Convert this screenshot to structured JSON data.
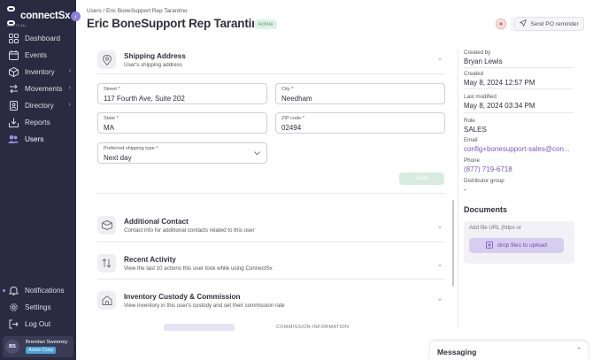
{
  "brand": {
    "name": "connectSx",
    "sub": "ASC-IT-ALL"
  },
  "sidebar": {
    "items": [
      {
        "label": "Dashboard",
        "icon": "dashboard-icon"
      },
      {
        "label": "Events",
        "icon": "calendar-icon"
      },
      {
        "label": "Inventory",
        "icon": "box-icon",
        "chevron": "›"
      },
      {
        "label": "Movements",
        "icon": "arrows-icon",
        "chevron": "›"
      },
      {
        "label": "Directory",
        "icon": "directory-icon",
        "chevron": "›"
      },
      {
        "label": "Reports",
        "icon": "reports-icon"
      },
      {
        "label": "Users",
        "icon": "users-icon"
      }
    ],
    "bottom": [
      {
        "label": "Notifications",
        "icon": "bell-icon"
      },
      {
        "label": "Settings",
        "icon": "gear-icon"
      },
      {
        "label": "Log Out",
        "icon": "logout-icon"
      }
    ],
    "collapse_glyph": "‹"
  },
  "user": {
    "initials": "BS",
    "name": "Brendan Sweeney",
    "org": "Acme Corp"
  },
  "header": {
    "breadcrumb": [
      "Users",
      "Eric BoneSupport Rep Tarantino"
    ],
    "breadcrumb_sep": " / ",
    "title": "Eric BoneSupport Rep Tarantino",
    "status": "Active",
    "reminder_label": "Send PO reminder"
  },
  "shipping": {
    "title": "Shipping Address",
    "subtitle": "User's shipping address",
    "chevron": "⌃",
    "street": {
      "label": "Street *",
      "value": "117 Fourth Ave, Suite 202"
    },
    "city": {
      "label": "City *",
      "value": "Needham"
    },
    "state": {
      "label": "State *",
      "value": "MA"
    },
    "zip": {
      "label": "ZIP code *",
      "value": "02494"
    },
    "shipping_type": {
      "label": "Preferred shipping type *",
      "value": "Next day"
    },
    "save_label": "Save"
  },
  "sections": {
    "contact": {
      "title": "Additional Contact",
      "subtitle": "Contact info for additional contacts related to this user",
      "chevron": "⌄"
    },
    "activity": {
      "title": "Recent Activity",
      "subtitle": "View the last 10 actions this user took while using ConnectSx",
      "chevron": "⌄"
    },
    "custody": {
      "title": "Inventory Custody & Commission",
      "subtitle": "View inventory in this user's custody and set their commission rate",
      "chevron": "⌃",
      "partial_label": "COMMISSION INFORMATION"
    }
  },
  "details": {
    "created_by": {
      "label": "Created by",
      "value": "Bryan Lewis"
    },
    "created": {
      "label": "Created",
      "value": "May 8, 2024 12:57 PM"
    },
    "modified": {
      "label": "Last modified",
      "value": "May 8, 2024 03:34 PM"
    },
    "role": {
      "label": "Role",
      "value": "SALES"
    },
    "email": {
      "label": "Email",
      "value": "config+bonesupport-sales@con..."
    },
    "phone": {
      "label": "Phone",
      "value": "(877) 719-6718"
    },
    "distributor": {
      "label": "Distributor group",
      "value": "-"
    }
  },
  "documents": {
    "title": "Documents",
    "url_placeholder": "Add file URL (https or",
    "drop_label": "drop files to upload"
  },
  "messaging": {
    "title": "Messaging",
    "chevron": "⌃"
  },
  "colors": {
    "sidebar": "#2a2b40",
    "accent": "#7c55c8",
    "active_badge": "#57a66a",
    "org_badge": "#4aa3d8"
  }
}
